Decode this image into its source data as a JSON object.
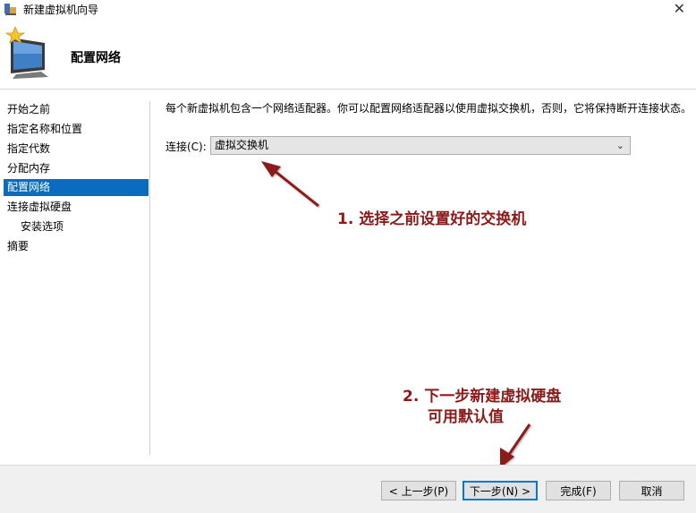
{
  "window": {
    "title": "新建虚拟机向导",
    "close_glyph": "✕"
  },
  "header": {
    "title": "配置网络",
    "icon": "wizard-monitor-star-icon"
  },
  "nav": {
    "items": [
      {
        "label": "开始之前",
        "active": false,
        "sub": false
      },
      {
        "label": "指定名称和位置",
        "active": false,
        "sub": false
      },
      {
        "label": "指定代数",
        "active": false,
        "sub": false
      },
      {
        "label": "分配内存",
        "active": false,
        "sub": false
      },
      {
        "label": "配置网络",
        "active": true,
        "sub": false
      },
      {
        "label": "连接虚拟硬盘",
        "active": false,
        "sub": false
      },
      {
        "label": "安装选项",
        "active": false,
        "sub": true
      },
      {
        "label": "摘要",
        "active": false,
        "sub": false
      }
    ]
  },
  "main": {
    "description": "每个新虚拟机包含一个网络适配器。你可以配置网络适配器以使用虚拟交换机，否则，它将保持断开连接状态。",
    "connection_label": "连接(C):",
    "connection_value": "虚拟交换机"
  },
  "annotations": {
    "note1": "1. 选择之前设置好的交换机",
    "note2_line1": "2. 下一步新建虚拟硬盘",
    "note2_line2": "可用默认值",
    "color": "#8b1a1a"
  },
  "footer": {
    "prev": "< 上一步(P)",
    "next": "下一步(N) >",
    "finish": "完成(F)",
    "cancel": "取消"
  },
  "colors": {
    "accent": "#0b6cbf",
    "annotation": "#8b1a1a"
  }
}
